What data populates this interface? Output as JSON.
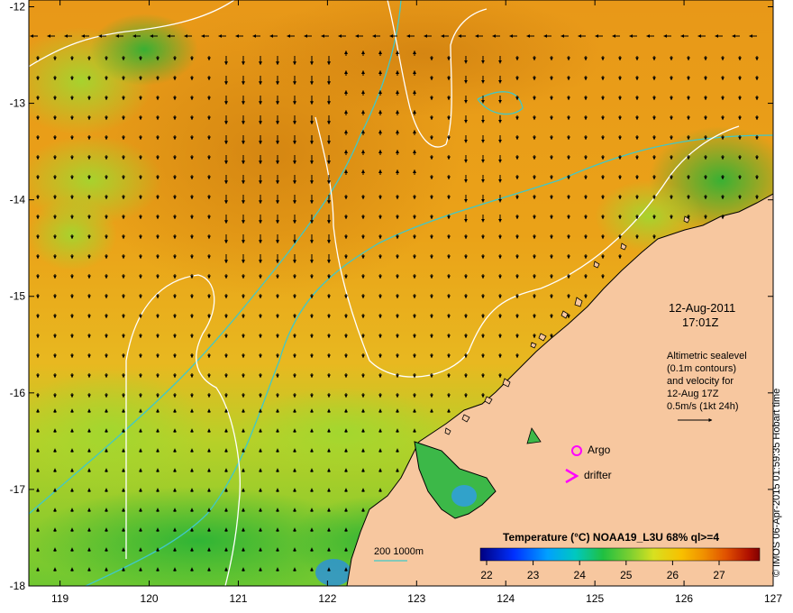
{
  "date": "12-Aug-2011",
  "time": "17:01Z",
  "info_lines": [
    "Altimetric sealevel",
    "(0.1m contours)",
    "and velocity for",
    "12-Aug 17Z",
    "0.5m/s (1kt 24h)"
  ],
  "argo_label": "Argo",
  "drifter_label": "drifter",
  "colorbar_title": "Temperature (°C) NOAA19_L3U 68% ql>=4",
  "colorbar_ticks": [
    "22",
    "23",
    "24",
    "25",
    "26",
    "27"
  ],
  "bathy_label": "200  1000m",
  "credit": "© IMOS 06-Apr-2015 01:59:35 Hobart time",
  "x_ticks": [
    "119",
    "120",
    "121",
    "122",
    "123",
    "124",
    "125",
    "126",
    "127"
  ],
  "y_ticks": [
    "-12",
    "-13",
    "-14",
    "-15",
    "-16",
    "-17",
    "-18"
  ],
  "colors": {
    "land": "#f7c79f",
    "warm": "#e08c10",
    "mid": "#f0a818",
    "cool": "#9cd630",
    "cold": "#2fb838",
    "bathy": "#40c8c8",
    "contour": "#ffffff",
    "marker": "#ff00ff"
  }
}
